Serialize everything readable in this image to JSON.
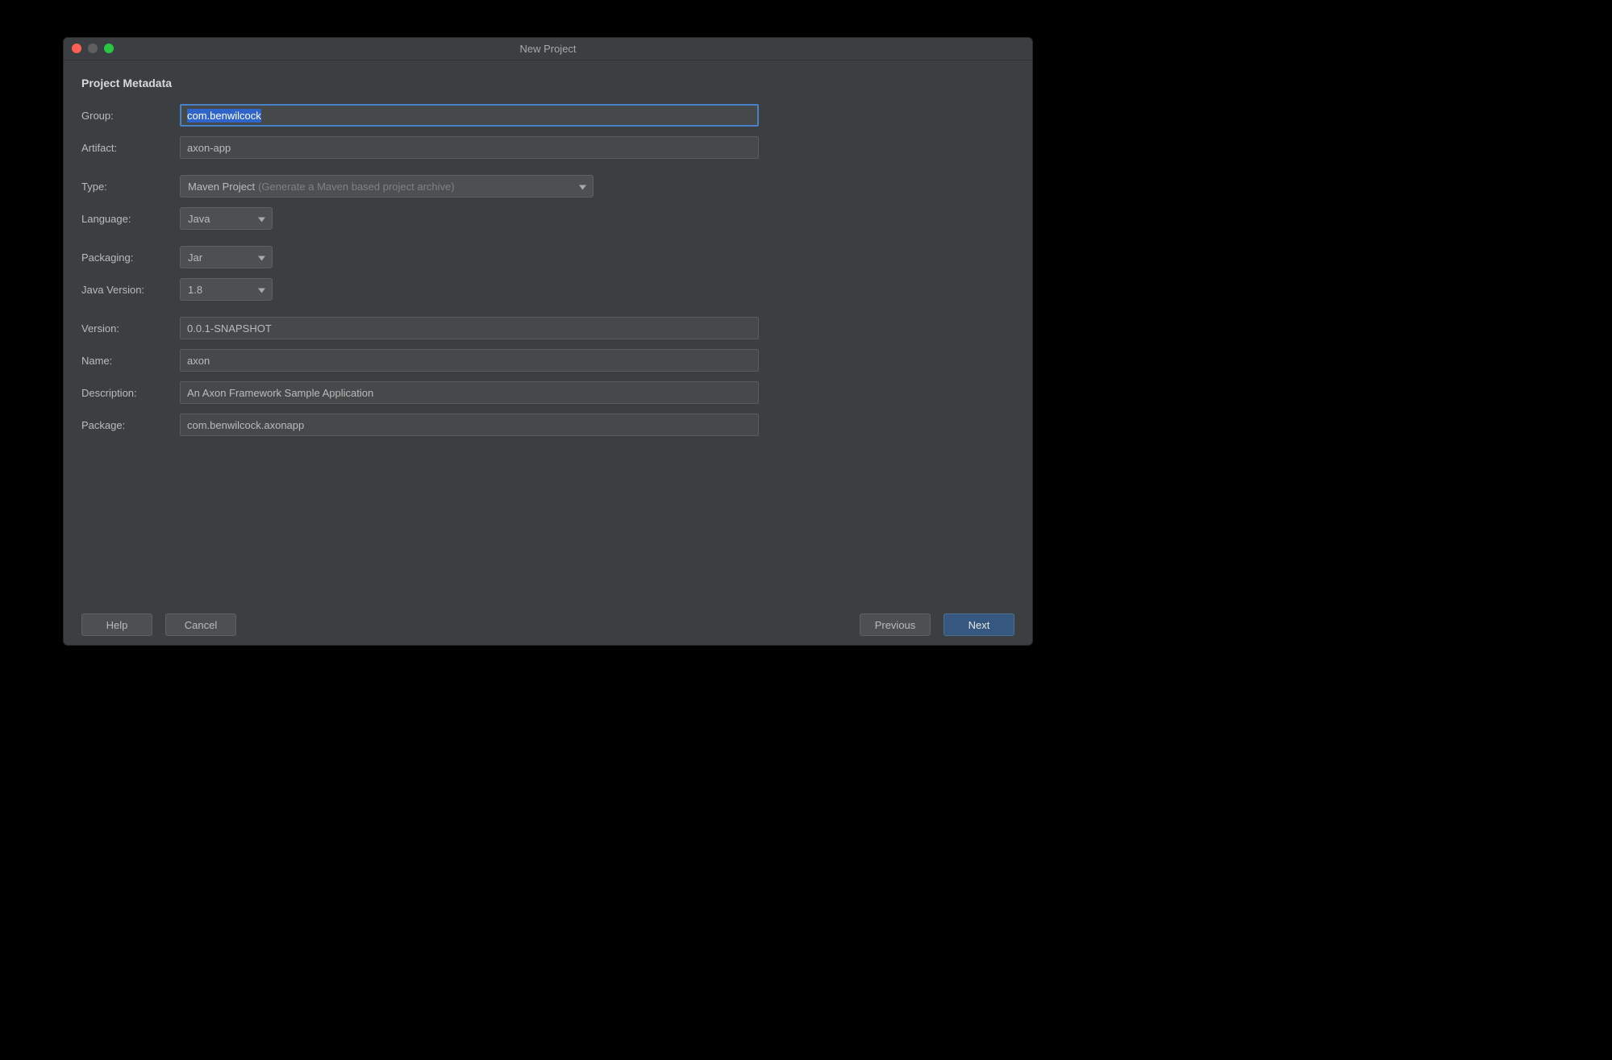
{
  "window": {
    "title": "New Project"
  },
  "section": {
    "header": "Project Metadata"
  },
  "fields": {
    "group_label": "Group:",
    "group_value": "com.benwilcock",
    "artifact_label": "Artifact:",
    "artifact_value": "axon-app",
    "type_label": "Type:",
    "type_value": "Maven Project",
    "type_hint": "(Generate a Maven based project archive)",
    "language_label": "Language:",
    "language_value": "Java",
    "packaging_label": "Packaging:",
    "packaging_value": "Jar",
    "javaversion_label": "Java Version:",
    "javaversion_value": "1.8",
    "version_label": "Version:",
    "version_value": "0.0.1-SNAPSHOT",
    "name_label": "Name:",
    "name_value": "axon",
    "description_label": "Description:",
    "description_value": "An Axon Framework Sample Application",
    "package_label": "Package:",
    "package_value": "com.benwilcock.axonapp"
  },
  "buttons": {
    "help": "Help",
    "cancel": "Cancel",
    "previous": "Previous",
    "next": "Next"
  }
}
